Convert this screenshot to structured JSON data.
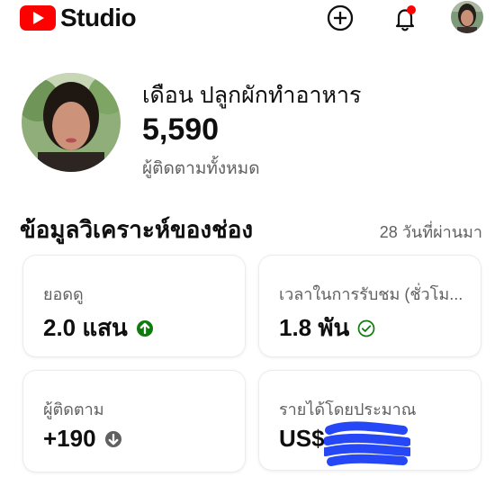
{
  "app": {
    "title": "Studio"
  },
  "top_actions": {
    "create_icon": "plus-circle-icon",
    "notifications_icon": "bell-icon",
    "notification_badge_color": "#ff0000"
  },
  "channel": {
    "name": "เดือน ปลูกผักทำอาหาร",
    "subscribers": "5,590",
    "subscribers_label": "ผู้ติดตามทั้งหมด"
  },
  "analytics": {
    "title": "ข้อมูลวิเคราะห์ของช่อง",
    "range": "28 วันที่ผ่านมา",
    "cards": [
      {
        "label": "ยอดดู",
        "value": "2.0 แสน",
        "status_icon": "arrow-up-circle-icon",
        "status_color": "#0f7b0f"
      },
      {
        "label": "เวลาในการรับชม (ชั่วโม...",
        "value": "1.8 พัน",
        "status_icon": "check-circle-icon",
        "status_color": "#0f7b0f"
      },
      {
        "label": "ผู้ติดตาม",
        "value": "+190",
        "status_icon": "arrow-down-circle-icon",
        "status_color": "#606060"
      },
      {
        "label": "รายได้โดยประมาณ",
        "value": "US$",
        "status_icon": "redaction-scribble",
        "status_color": "#1a3df5"
      }
    ]
  }
}
